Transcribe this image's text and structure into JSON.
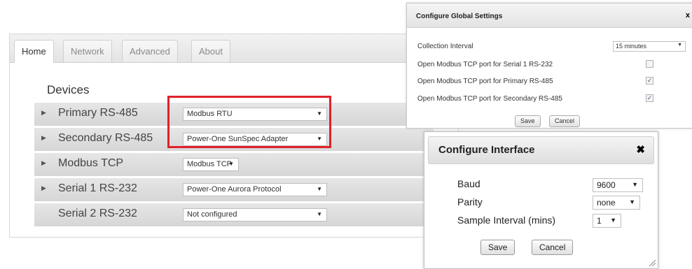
{
  "tabs": [
    {
      "label": "Home",
      "active": true
    },
    {
      "label": "Network",
      "active": false
    },
    {
      "label": "Advanced",
      "active": false
    },
    {
      "label": "About",
      "active": false
    }
  ],
  "devices": {
    "title": "Devices",
    "rows": [
      {
        "label": "Primary RS-485",
        "protocol": "Modbus RTU",
        "expand_icon": "triangle-right-icon"
      },
      {
        "label": "Secondary RS-485",
        "protocol": "Power-One SunSpec Adapter",
        "expand_icon": "triangle-right-icon"
      },
      {
        "label": "Modbus TCP",
        "protocol": "Modbus TCP",
        "expand_icon": "triangle-right-icon"
      },
      {
        "label": "Serial 1 RS-232",
        "protocol": "Power-One Aurora Protocol",
        "expand_icon": "triangle-right-icon"
      },
      {
        "label": "Serial 2 RS-232",
        "protocol": "Not configured",
        "expand_icon": ""
      }
    ],
    "highlight_color": "#e0212b"
  },
  "global_dialog": {
    "title": "Configure Global Settings",
    "close_label": "x",
    "collection_interval_label": "Collection Interval",
    "collection_interval_value": "15 minutes",
    "options": [
      {
        "label": "Open Modbus TCP port for Serial 1 RS-232",
        "checked": false
      },
      {
        "label": "Open Modbus TCP port for Primary RS-485",
        "checked": true
      },
      {
        "label": "Open Modbus TCP port for Secondary RS-485",
        "checked": true
      }
    ],
    "save_label": "Save",
    "cancel_label": "Cancel"
  },
  "interface_dialog": {
    "title": "Configure Interface",
    "close_label": "✖",
    "baud_label": "Baud",
    "baud_value": "9600",
    "parity_label": "Parity",
    "parity_value": "none",
    "sample_label": "Sample Interval (mins)",
    "sample_value": "1",
    "save_label": "Save",
    "cancel_label": "Cancel"
  }
}
